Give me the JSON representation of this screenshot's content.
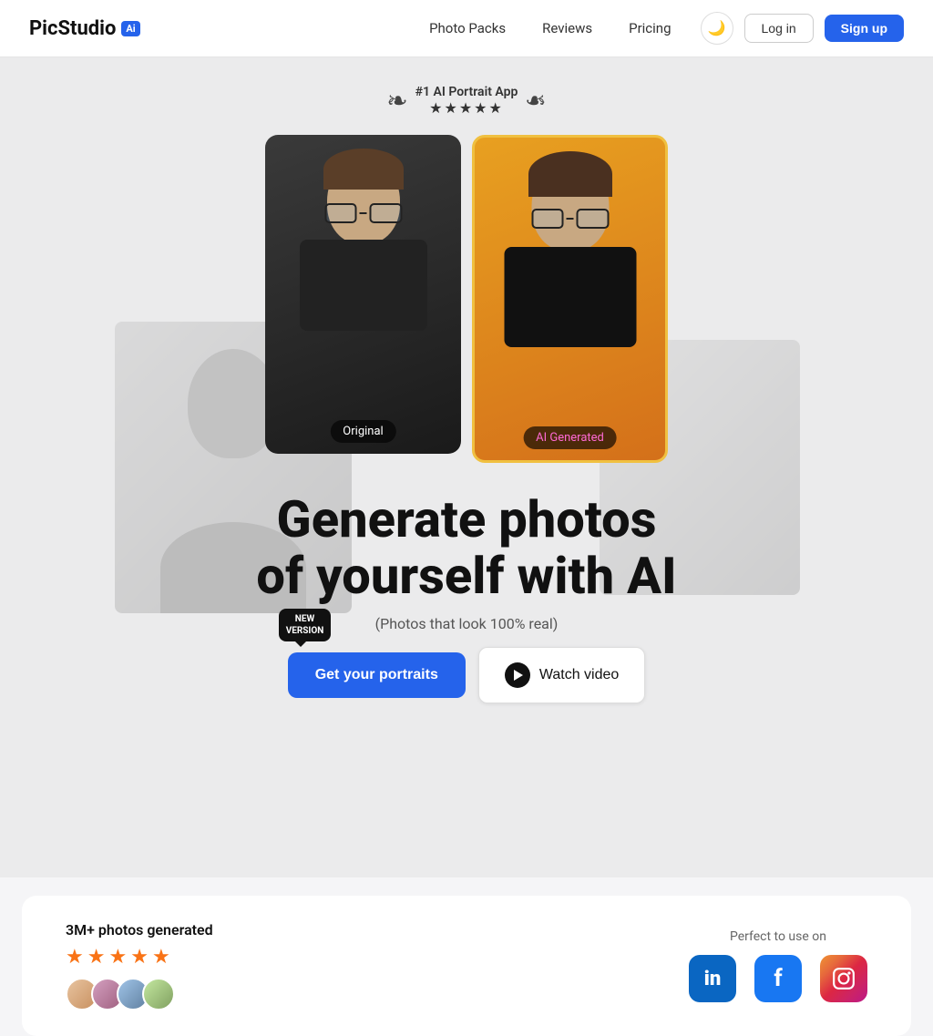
{
  "app": {
    "name": "PicStudio",
    "ai_badge": "Ai"
  },
  "navbar": {
    "photo_packs": "Photo Packs",
    "reviews": "Reviews",
    "pricing": "Pricing",
    "login": "Log in",
    "signup": "Sign up"
  },
  "hero": {
    "award_title": "#1 AI Portrait App",
    "stars": "★★★★★",
    "headline_line1": "Generate photos",
    "headline_line2": "of yourself with AI",
    "subheadline": "(Photos that look 100% real)",
    "new_version_badge_line1": "NEW",
    "new_version_badge_line2": "VERSION",
    "cta_primary": "Get your portraits",
    "cta_secondary": "Watch video",
    "label_original": "Original",
    "label_ai": "AI Generated"
  },
  "social_proof": {
    "count_label": "3M+ photos generated",
    "platforms_label": "Perfect to use on"
  },
  "icons": {
    "linkedin": "in",
    "facebook": "f",
    "instagram": "📷"
  }
}
